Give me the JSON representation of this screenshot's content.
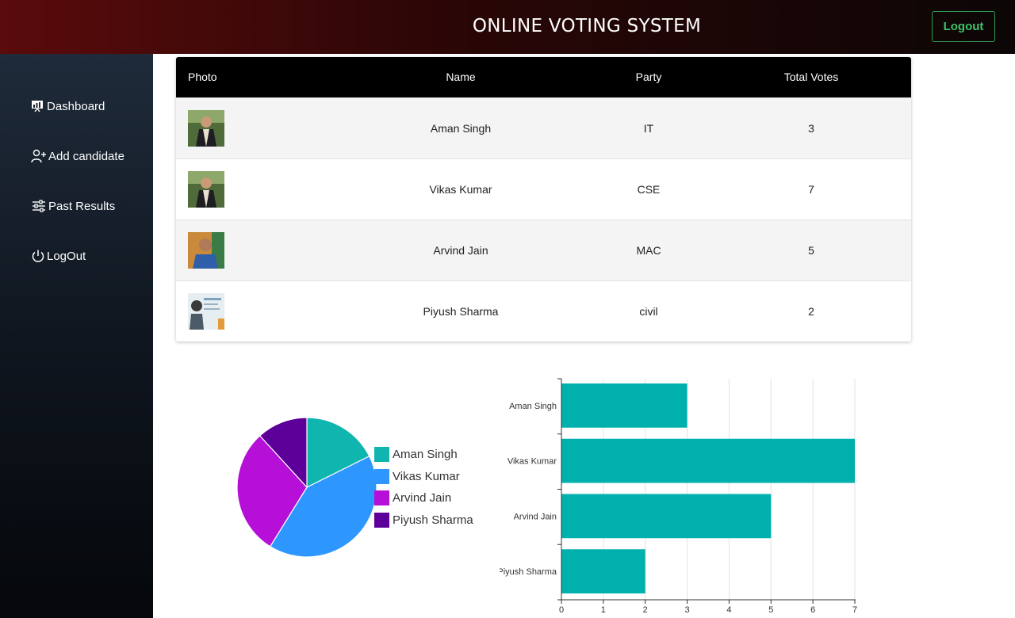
{
  "header": {
    "title": "ONLINE VOTING SYSTEM",
    "logout_label": "Logout"
  },
  "sidebar": {
    "items": [
      {
        "label": "Dashboard",
        "icon": "presentation-chart-icon"
      },
      {
        "label": "Add candidate",
        "icon": "person-add-icon"
      },
      {
        "label": "Past Results",
        "icon": "sliders-icon"
      },
      {
        "label": "LogOut",
        "icon": "power-icon"
      }
    ]
  },
  "table": {
    "headers": {
      "photo": "Photo",
      "name": "Name",
      "party": "Party",
      "votes": "Total Votes"
    },
    "rows": [
      {
        "name": "Aman Singh",
        "party": "IT",
        "votes": "3"
      },
      {
        "name": "Vikas Kumar",
        "party": "CSE",
        "votes": "7"
      },
      {
        "name": "Arvind Jain",
        "party": "MAC",
        "votes": "5"
      },
      {
        "name": "Piyush Sharma",
        "party": "civil",
        "votes": "2"
      }
    ]
  },
  "chart_data": [
    {
      "type": "pie",
      "categories": [
        "Aman Singh",
        "Vikas Kumar",
        "Arvind Jain",
        "Piyush Sharma"
      ],
      "values": [
        3,
        7,
        5,
        2
      ],
      "colors": [
        "#0fb5ae",
        "#2d97ff",
        "#b50fd8",
        "#5c0099"
      ],
      "legend": "right"
    },
    {
      "type": "bar",
      "orientation": "horizontal",
      "categories": [
        "Aman Singh",
        "Vikas Kumar",
        "Arvind Jain",
        "Piyush Sharma"
      ],
      "values": [
        3,
        7,
        5,
        2
      ],
      "color": "#00b0ad",
      "xlim": [
        0,
        7
      ],
      "xticks": [
        "0",
        "1",
        "2",
        "3",
        "4",
        "5",
        "6",
        "7"
      ],
      "grid": true
    }
  ]
}
